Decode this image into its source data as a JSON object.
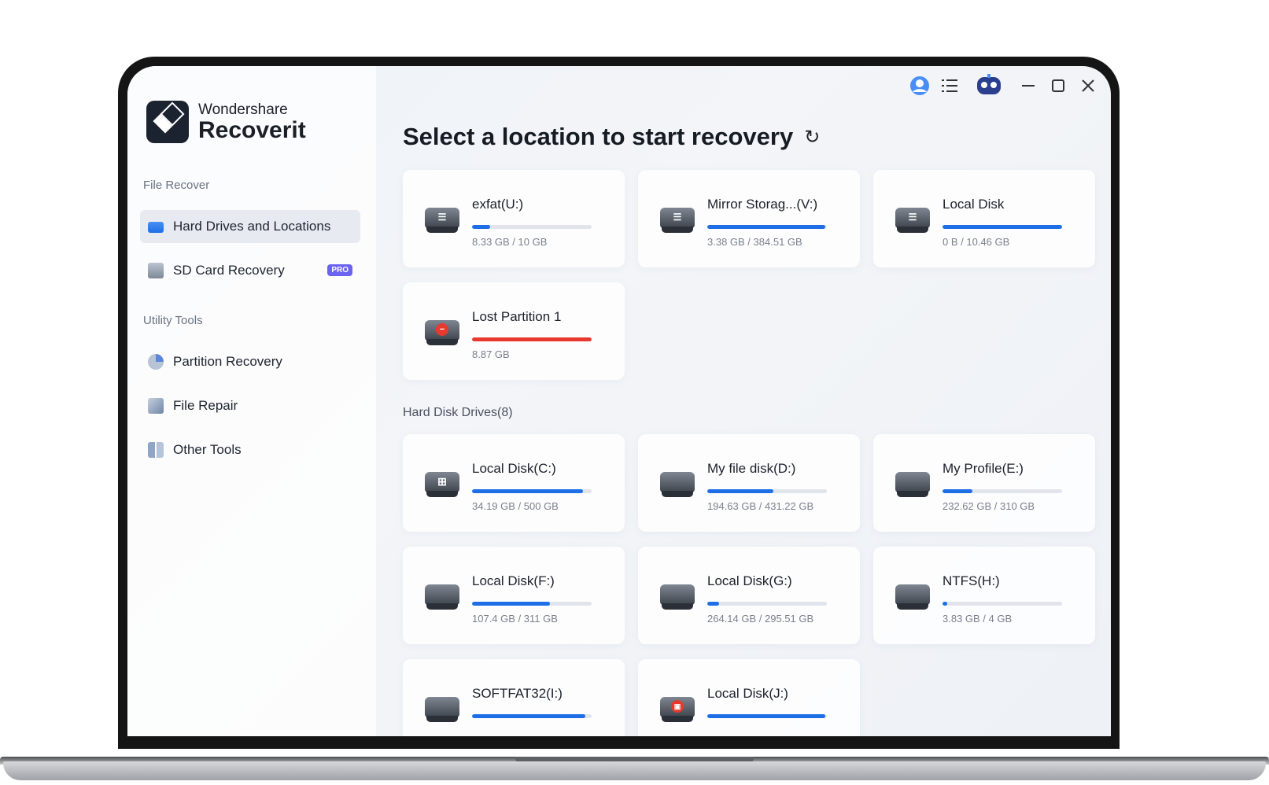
{
  "app": {
    "brand": "Wondershare",
    "name": "Recoverit"
  },
  "sidebar": {
    "section_file": "File Recover",
    "section_utility": "Utility Tools",
    "items": [
      {
        "label": "Hard Drives and Locations",
        "icon": "hard-drive-icon",
        "active": true
      },
      {
        "label": "SD Card Recovery",
        "icon": "sd-card-icon",
        "badge": "PRO"
      },
      {
        "label": "Partition Recovery",
        "icon": "pie-chart-icon"
      },
      {
        "label": "File Repair",
        "icon": "file-repair-icon"
      },
      {
        "label": "Other Tools",
        "icon": "tools-grid-icon"
      }
    ]
  },
  "toolbar": {
    "icons": [
      "user-avatar-icon",
      "menu-list-icon",
      "robot-assistant-icon",
      "minimize-icon",
      "maximize-icon",
      "close-icon"
    ]
  },
  "main": {
    "title": "Select a location to start recovery",
    "hard_disk_section": "Hard Disk Drives(8)"
  },
  "colors": {
    "accent": "#1e6fe6",
    "danger": "#e8392f",
    "pro_badge": "#6b62f2"
  },
  "external_drives": [
    {
      "name": "exfat(U:)",
      "size": "8.33 GB / 10 GB",
      "fill": 0.15,
      "icon": "usb-drive-icon"
    },
    {
      "name": "Mirror Storag...(V:)",
      "size": "3.38 GB / 384.51 GB",
      "fill": 0.99,
      "icon": "usb-drive-icon"
    },
    {
      "name": "Local Disk",
      "size": "0 B / 10.46 GB",
      "fill": 1.0,
      "icon": "usb-drive-icon"
    },
    {
      "name": "Lost Partition 1",
      "size": "8.87 GB",
      "fill": 1.0,
      "icon": "lost-partition-icon",
      "danger": true
    }
  ],
  "hard_disk_drives": [
    {
      "name": "Local Disk(C:)",
      "size": "34.19 GB / 500 GB",
      "fill": 0.93,
      "icon": "windows-drive-icon"
    },
    {
      "name": "My file disk(D:)",
      "size": "194.63 GB / 431.22 GB",
      "fill": 0.55,
      "icon": "hard-drive-icon"
    },
    {
      "name": "My Profile(E:)",
      "size": "232.62 GB / 310 GB",
      "fill": 0.25,
      "icon": "hard-drive-icon"
    },
    {
      "name": "Local Disk(F:)",
      "size": "107.4 GB / 311 GB",
      "fill": 0.65,
      "icon": "hard-drive-icon"
    },
    {
      "name": "Local Disk(G:)",
      "size": "264.14 GB / 295.51 GB",
      "fill": 0.1,
      "icon": "hard-drive-icon"
    },
    {
      "name": "NTFS(H:)",
      "size": "3.83 GB / 4 GB",
      "fill": 0.04,
      "icon": "hard-drive-icon"
    },
    {
      "name": "SOFTFAT32(I:)",
      "size": "",
      "fill": 0.95,
      "icon": "hard-drive-icon"
    },
    {
      "name": "Local Disk(J:)",
      "size": "",
      "fill": 0.99,
      "icon": "locked-drive-icon"
    }
  ]
}
